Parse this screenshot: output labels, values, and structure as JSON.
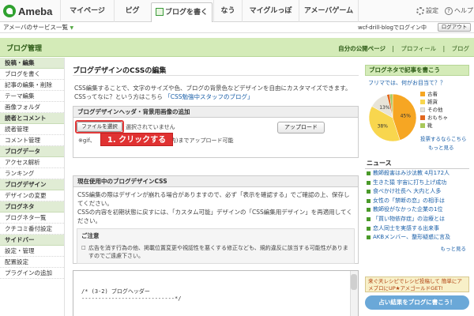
{
  "topnav": {
    "logo": "Ameba",
    "tabs": [
      "マイページ",
      "ピグ",
      "ブログを書く",
      "なう",
      "マイグルっぽ",
      "アメーバゲーム"
    ],
    "settings": "設定",
    "help": "ヘルプ"
  },
  "servicebar": {
    "services_link": "アメーバのサービス一覧",
    "login_status": "wcf-drill-blogでログイン中",
    "logout": "ログアウト"
  },
  "header": {
    "title": "ブログ管理",
    "links": [
      "自分の公開ページ",
      "プロフィール",
      "ブログ"
    ]
  },
  "sidebar": {
    "sections": [
      {
        "title": "投稿・編集",
        "items": [
          "ブログを書く",
          "記事の編集・削除",
          "テーマ編集",
          "画像フォルダ"
        ]
      },
      {
        "title": "読者とコメント",
        "items": [
          "読者管理",
          "コメント管理"
        ]
      },
      {
        "title": "ブログデータ",
        "items": [
          "アクセス解析",
          "ランキング"
        ]
      },
      {
        "title": "ブログデザイン",
        "items": [
          "デザインの変更"
        ]
      },
      {
        "title": "ブログネタ",
        "items": [
          "ブログネタ一覧",
          "クチコミ番付設定"
        ]
      },
      {
        "title": "サイドバー",
        "items": [
          "設定・管理",
          "配置設定",
          "プラグインの追加"
        ]
      }
    ]
  },
  "main": {
    "title": "ブログデザインのCSSの編集",
    "intro_line1": "CSS編集することで、文字のサイズや色、ブログの背景色などデザインを自由にカスタマイズできます。",
    "intro_line2": "CSSってなに？という方はこちら",
    "intro_link": "「CSS勉強中スタッフのブログ」",
    "upload": {
      "heading": "ブログデザインヘッダ・背景用画像の追加",
      "file_button": "ファイルを選択",
      "no_file": "選択されていません",
      "upload_button": "アップロード",
      "hint_prefix": "※gif、",
      "hint_suffix": "以内)までアップロード可能",
      "callout": "1. クリックする"
    },
    "current_css": {
      "heading": "現在使用中のブログデザインCSS",
      "line1": "CSS編集の際はデザインが崩れる場合がありますので、必ず「表示を確認する」でご確認の上、保存してください。",
      "line2": "CSSの内容を初期状態に戻すには、「カスタム可能」デザインの「CSS編集用デザイン」を再適用してください。"
    },
    "notice": {
      "title": "ご注意",
      "body": "広告を消す行為の他、掲載位置変更や視認性を悪くする修正なども、規約違反に該当する可能性がありますのでご遠慮下さい。"
    },
    "editor": {
      "line1": "/* (3-2) ブログヘッダー",
      "line2": "----------------------------*/"
    }
  },
  "right": {
    "panel_title": "ブログネタで記事を書こう",
    "poll_question": "フリマでは、何がお目当て？？",
    "poll_legend": [
      "古着",
      "雑貨",
      "その他",
      "おもちゃ",
      "靴"
    ],
    "poll_colors": [
      "#f6a623",
      "#f8d64e",
      "#e8e4d8",
      "#e2671e",
      "#a8c85a"
    ],
    "pie_labels": [
      "45%",
      "38%",
      "13%"
    ],
    "pie_values": [
      45,
      38,
      13,
      2,
      2
    ],
    "vote_link": "投票するならこちら",
    "more_link": "もっと見る",
    "news_title": "ニュース",
    "news": [
      "教師殺害はみ沙汰教 4月172人",
      "生きた猿 宇宙に打ち上げ成功",
      "食べかけ社長へ 大内と人多",
      "女性の「禁断の恋」の相手は",
      "教師役がなかった企業の1位",
      "「買い物依存症」の治療とは",
      "恋人同士を実感する出来事",
      "AKBメンバー、整形疑惑に言及"
    ],
    "more_news": "もっと見る",
    "banner1": "来ぐ天レシピでレシピ投稿して 簡単にアメブロにUP★アメゴールドGET!",
    "banner2": "占い結果をブログに書こう！"
  }
}
